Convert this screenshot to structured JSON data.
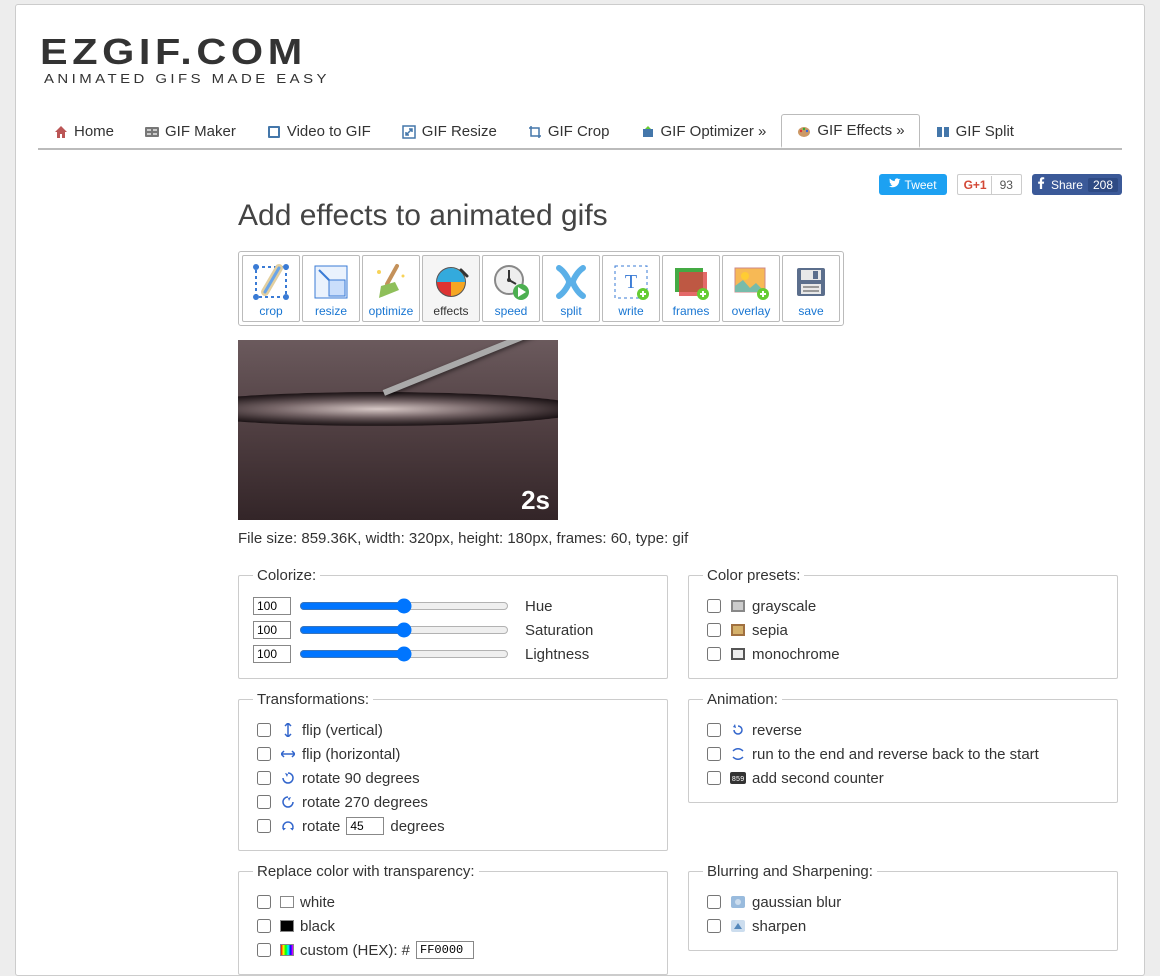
{
  "logo": {
    "main": "EZGIF.COM",
    "sub": "ANIMATED GIFS MADE EASY"
  },
  "nav": [
    {
      "label": "Home"
    },
    {
      "label": "GIF Maker"
    },
    {
      "label": "Video to GIF"
    },
    {
      "label": "GIF Resize"
    },
    {
      "label": "GIF Crop"
    },
    {
      "label": "GIF Optimizer »"
    },
    {
      "label": "GIF Effects »"
    },
    {
      "label": "GIF Split"
    }
  ],
  "share": {
    "tweet": "Tweet",
    "gplus_count": "93",
    "fb_label": "Share",
    "fb_count": "208"
  },
  "heading": "Add effects to animated gifs",
  "tools": [
    {
      "label": "crop"
    },
    {
      "label": "resize"
    },
    {
      "label": "optimize"
    },
    {
      "label": "effects"
    },
    {
      "label": "speed"
    },
    {
      "label": "split"
    },
    {
      "label": "write"
    },
    {
      "label": "frames"
    },
    {
      "label": "overlay"
    },
    {
      "label": "save"
    }
  ],
  "preview": {
    "timecode": "2s"
  },
  "file_info": "File size: 859.36K, width: 320px, height: 180px, frames: 60, type: gif",
  "colorize": {
    "legend": "Colorize:",
    "hue": {
      "value": "100",
      "label": "Hue"
    },
    "saturation": {
      "value": "100",
      "label": "Saturation"
    },
    "lightness": {
      "value": "100",
      "label": "Lightness"
    }
  },
  "color_presets": {
    "legend": "Color presets:",
    "grayscale": "grayscale",
    "sepia": "sepia",
    "monochrome": "monochrome"
  },
  "transform": {
    "legend": "Transformations:",
    "flip_v": "flip (vertical)",
    "flip_h": "flip (horizontal)",
    "rot90": "rotate 90 degrees",
    "rot270": "rotate 270 degrees",
    "rot_custom_pre": "rotate",
    "rot_custom_val": "45",
    "rot_custom_post": "degrees"
  },
  "animation": {
    "legend": "Animation:",
    "reverse": "reverse",
    "bounce": "run to the end and reverse back to the start",
    "counter": "add second counter"
  },
  "replace_color": {
    "legend": "Replace color with transparency:",
    "white": "white",
    "black": "black",
    "custom_label": "custom (HEX): #",
    "custom_value": "FF0000"
  },
  "blur": {
    "legend": "Blurring and Sharpening:",
    "gaussian": "gaussian blur",
    "sharpen": "sharpen"
  }
}
